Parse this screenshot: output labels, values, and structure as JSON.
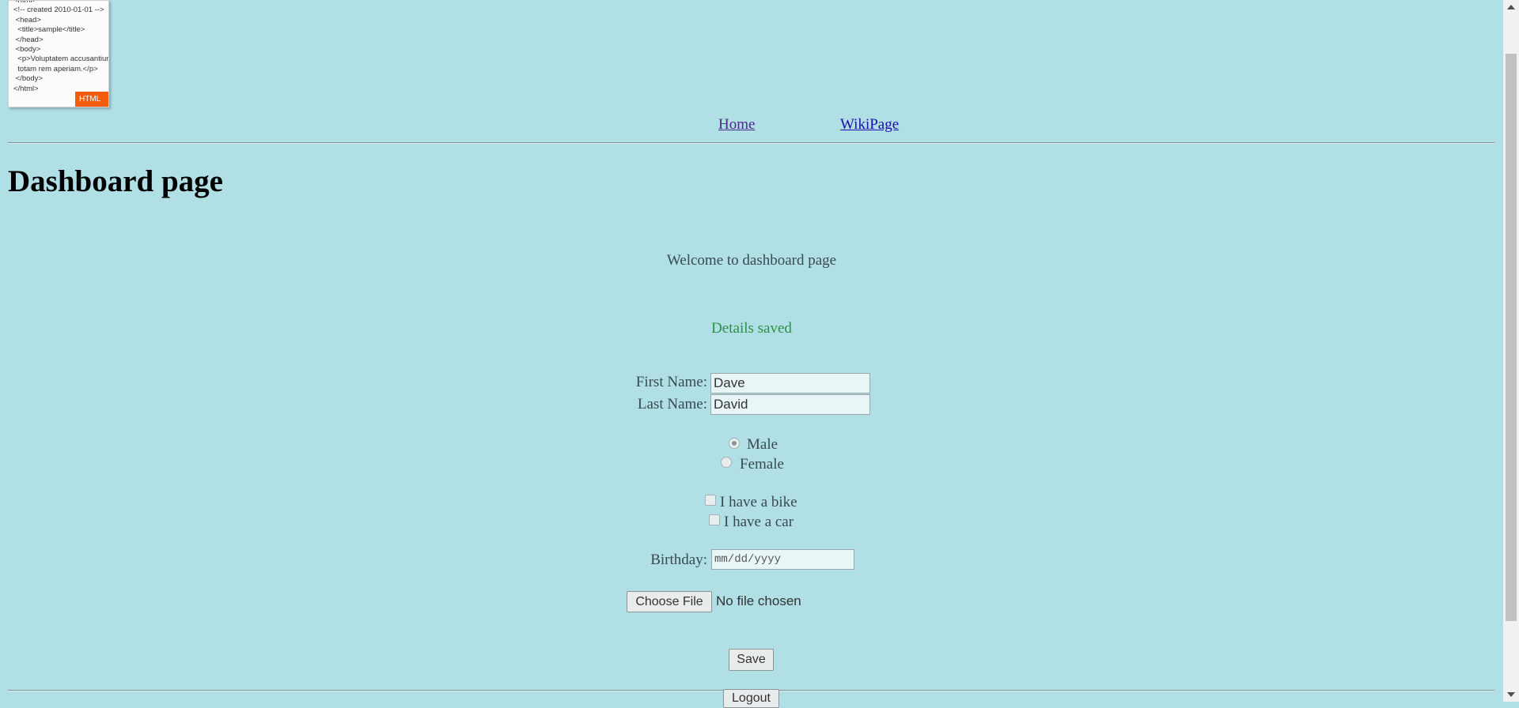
{
  "logo": {
    "code_lines": [
      "<html>",
      "<!-- created 2010-01-01 -->",
      " <head>",
      "  <title>sample</title>",
      " </head>",
      " <body>",
      "  <p>Voluptatem accusantium",
      "  totam rem aperiam.</p>",
      " </body>",
      "</html>"
    ],
    "badge": "HTML"
  },
  "nav": {
    "home": "Home",
    "wiki": "WikiPage"
  },
  "page_title": "Dashboard page",
  "welcome_text": "Welcome to dashboard page",
  "status_message": "Details saved",
  "form": {
    "first_name_label": "First Name:",
    "first_name_value": "Dave",
    "last_name_label": "Last Name:",
    "last_name_value": "David",
    "gender_options": [
      {
        "label": "Male",
        "selected": true
      },
      {
        "label": "Female",
        "selected": false
      }
    ],
    "vehicles": [
      {
        "label": "I have a bike",
        "checked": false
      },
      {
        "label": "I have a car",
        "checked": false
      }
    ],
    "birthday_label": "Birthday:",
    "birthday_placeholder": "mm/dd/yyyy",
    "file_button": "Choose File",
    "file_status": "No file chosen",
    "save_button": "Save"
  },
  "logout_button": "Logout",
  "colors": {
    "background": "#b0dfe5",
    "success": "#2f8f45",
    "link": "#1a0dab",
    "visited_link": "#4b2a8a"
  }
}
